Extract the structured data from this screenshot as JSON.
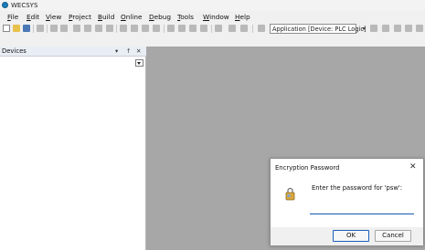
{
  "window": {
    "title": "WECSYS"
  },
  "menu": [
    {
      "label": "File",
      "accel": "F"
    },
    {
      "label": "Edit",
      "accel": "E"
    },
    {
      "label": "View",
      "accel": "V"
    },
    {
      "label": "Project",
      "accel": "P"
    },
    {
      "label": "Build",
      "accel": "B"
    },
    {
      "label": "Online",
      "accel": "O"
    },
    {
      "label": "Debug",
      "accel": "D"
    },
    {
      "label": "Tools",
      "accel": "T"
    },
    {
      "label": "Window",
      "accel": "W"
    },
    {
      "label": "Help",
      "accel": "H"
    }
  ],
  "toolbar": {
    "active_application": "Application [Device: PLC Logic]"
  },
  "devices_panel": {
    "title": "Devices",
    "pin_label": "↑",
    "close_label": "✕",
    "menu_label": "▾"
  },
  "dialog": {
    "title": "Encryption Password",
    "close_label": "✕",
    "prompt": "Enter the password for 'psw':",
    "password_value": "",
    "ok_label": "OK",
    "cancel_label": "Cancel"
  }
}
